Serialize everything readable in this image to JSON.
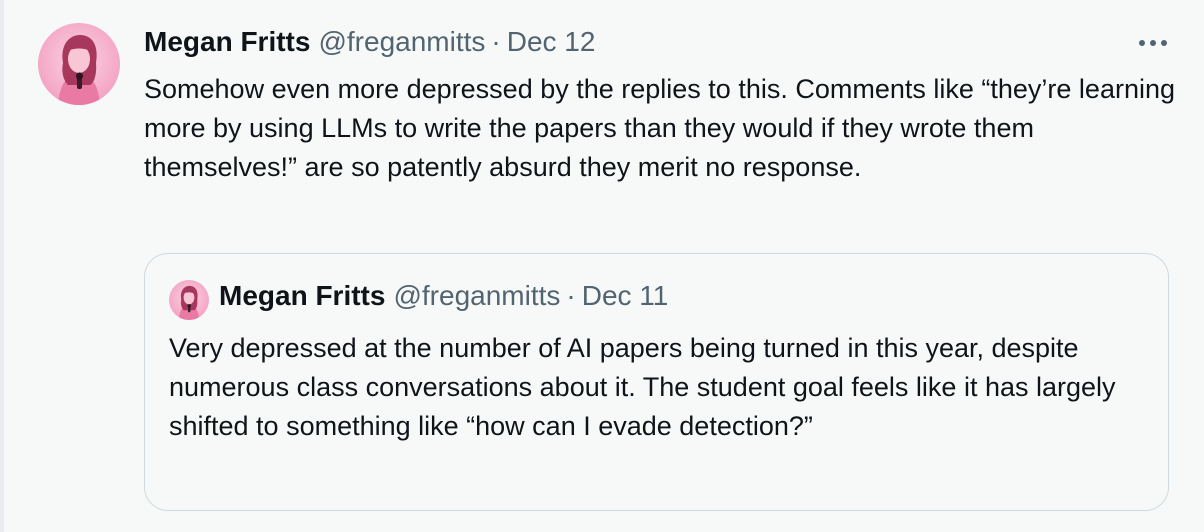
{
  "tweet": {
    "author": {
      "name": "Megan Fritts",
      "handle": "@freganmitts",
      "separator": "·",
      "date": "Dec 12"
    },
    "text": "Somehow even more depressed by the replies to this. Comments like “they’re learning more by using LLMs to write the papers than they would if they wrote them themselves!” are so patently absurd they merit no response.",
    "more_icon": "more-horizontal-icon"
  },
  "quoted_tweet": {
    "author": {
      "name": "Megan Fritts",
      "handle": "@freganmitts",
      "separator": "·",
      "date": "Dec 11"
    },
    "text": "Very depressed at the number of AI papers being turned in this year, despite numerous class conversations about it. The student goal feels like it has largely shifted to something like “how can I evade detection?”"
  },
  "colors": {
    "background": "#f7f9f9",
    "text_primary": "#0f1419",
    "text_secondary": "#536471",
    "border": "#cfd9de",
    "avatar_tint": "#f4a6c4"
  }
}
